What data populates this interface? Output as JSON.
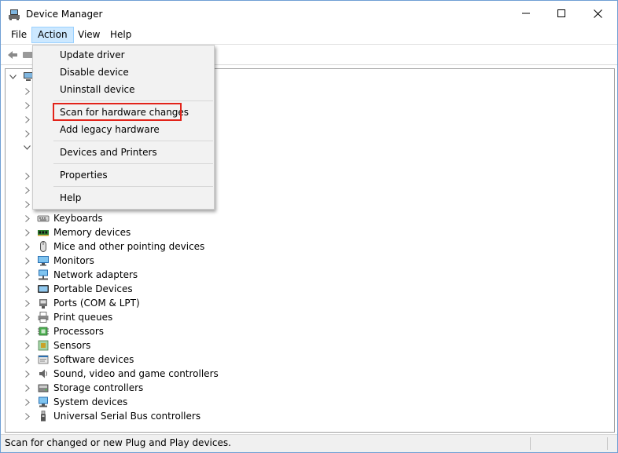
{
  "window": {
    "title": "Device Manager",
    "controls": {
      "minimize": "minimize",
      "maximize": "maximize",
      "close": "close"
    }
  },
  "menubar": {
    "items": [
      {
        "label": "File",
        "active": false
      },
      {
        "label": "Action",
        "active": true
      },
      {
        "label": "View",
        "active": false
      },
      {
        "label": "Help",
        "active": false
      }
    ]
  },
  "action_menu": {
    "items": [
      {
        "label": "Update driver"
      },
      {
        "label": "Disable device"
      },
      {
        "label": "Uninstall device"
      },
      {
        "label": "Scan for hardware changes",
        "highlighted": true
      },
      {
        "label": "Add legacy hardware"
      },
      {
        "label": "Devices and Printers"
      },
      {
        "label": "Properties"
      },
      {
        "label": "Help"
      }
    ],
    "highlight_color": "#e2231a"
  },
  "tree": {
    "visible_categories": [
      {
        "label": "Keyboards",
        "icon": "keyboard-icon"
      },
      {
        "label": "Memory devices",
        "icon": "memory-icon"
      },
      {
        "label": "Mice and other pointing devices",
        "icon": "mouse-icon"
      },
      {
        "label": "Monitors",
        "icon": "monitor-icon"
      },
      {
        "label": "Network adapters",
        "icon": "network-icon"
      },
      {
        "label": "Portable Devices",
        "icon": "portable-device-icon"
      },
      {
        "label": "Ports (COM & LPT)",
        "icon": "port-icon"
      },
      {
        "label": "Print queues",
        "icon": "printer-icon"
      },
      {
        "label": "Processors",
        "icon": "processor-icon"
      },
      {
        "label": "Sensors",
        "icon": "sensor-icon"
      },
      {
        "label": "Software devices",
        "icon": "software-device-icon"
      },
      {
        "label": "Sound, video and game controllers",
        "icon": "speaker-icon"
      },
      {
        "label": "Storage controllers",
        "icon": "storage-icon"
      },
      {
        "label": "System devices",
        "icon": "system-device-icon"
      },
      {
        "label": "Universal Serial Bus controllers",
        "icon": "usb-icon"
      }
    ]
  },
  "statusbar": {
    "text": "Scan for changed or new Plug and Play devices."
  },
  "colors": {
    "menu_active_bg": "#cce8ff",
    "menu_active_border": "#99d1ff",
    "dropdown_bg": "#f2f2f2",
    "statusbar_bg": "#f0f0f0"
  }
}
